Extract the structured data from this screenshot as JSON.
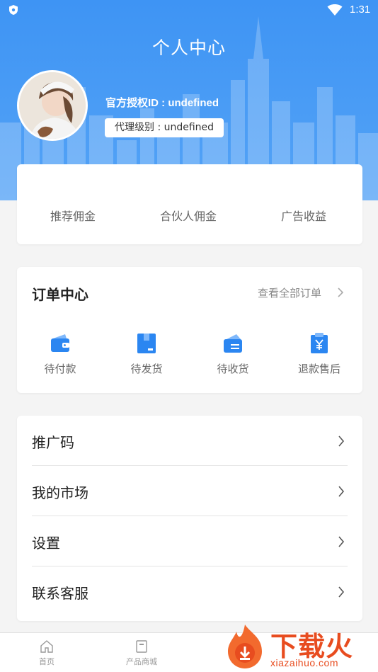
{
  "status_bar": {
    "time": "1:31"
  },
  "header": {
    "title": "个人中心",
    "official_id": "官方授权ID : undefined",
    "agent_level": "代理级别 : undefined"
  },
  "earnings": {
    "items": [
      "推荐佣金",
      "合伙人佣金",
      "广告收益"
    ]
  },
  "orders": {
    "title": "订单中心",
    "view_all": "查看全部订单",
    "items": [
      {
        "label": "待付款",
        "icon": "wallet-icon"
      },
      {
        "label": "待发货",
        "icon": "package-icon"
      },
      {
        "label": "待收货",
        "icon": "receive-icon"
      },
      {
        "label": "退款售后",
        "icon": "refund-icon"
      }
    ]
  },
  "menu": {
    "items": [
      "推广码",
      "我的市场",
      "设置",
      "联系客服"
    ]
  },
  "tabbar": {
    "items": [
      {
        "label": "首页",
        "icon": "home-icon"
      },
      {
        "label": "产品商城",
        "icon": "store-icon"
      }
    ]
  },
  "watermark": {
    "cn": "下载火",
    "en": "xiazaihuo.com"
  },
  "colors": {
    "primary": "#3e94f4",
    "accent": "#e84c1f"
  }
}
